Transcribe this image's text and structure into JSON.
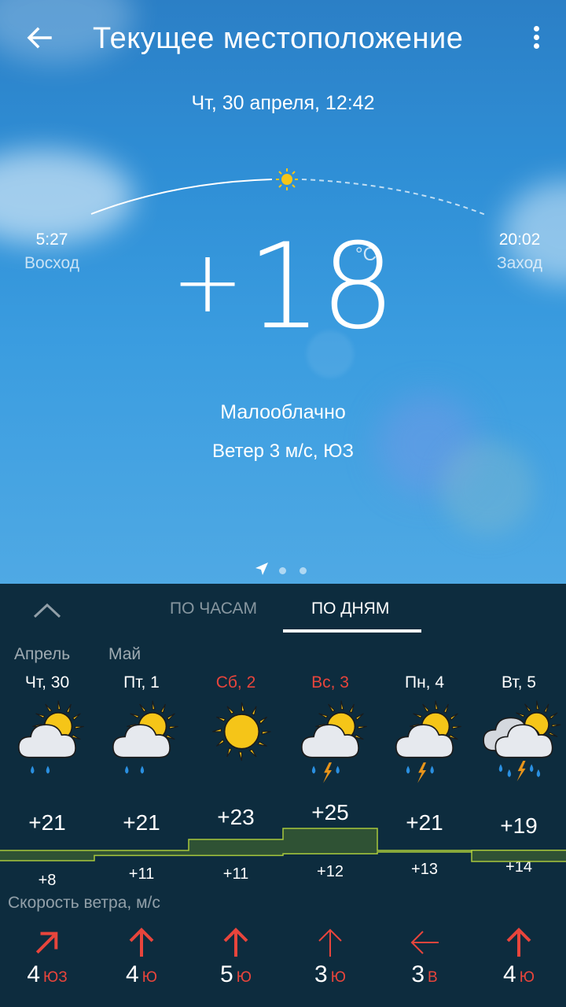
{
  "header": {
    "title": "Текущее местоположение",
    "datetime": "Чт, 30 апреля, 12:42"
  },
  "sun": {
    "sunrise_time": "5:27",
    "sunrise_label": "Восход",
    "sunset_time": "20:02",
    "sunset_label": "Заход"
  },
  "current": {
    "sign": "+",
    "temp": "18",
    "unit": "°C",
    "condition": "Малооблачно",
    "wind": "Ветер 3 м/с, ЮЗ"
  },
  "tabs": {
    "hours": "ПО ЧАСАМ",
    "days": "ПО ДНЯМ"
  },
  "months": [
    "Апрель",
    "Май"
  ],
  "days": [
    {
      "label": "Чт, 30",
      "weekend": false,
      "icon": "partly-cloudy-rain-icon",
      "max": "+21",
      "min": "+8",
      "wind_speed": "4",
      "wind_dir": "ЮЗ"
    },
    {
      "label": "Пт, 1",
      "weekend": false,
      "icon": "partly-cloudy-rain-icon",
      "max": "+21",
      "min": "+11",
      "wind_speed": "4",
      "wind_dir": "Ю"
    },
    {
      "label": "Сб, 2",
      "weekend": true,
      "icon": "sunny-icon",
      "max": "+23",
      "min": "+11",
      "wind_speed": "5",
      "wind_dir": "Ю"
    },
    {
      "label": "Вс, 3",
      "weekend": true,
      "icon": "partly-cloudy-thunderstorm-icon",
      "max": "+25",
      "min": "+12",
      "wind_speed": "3",
      "wind_dir": "Ю"
    },
    {
      "label": "Пн, 4",
      "weekend": false,
      "icon": "partly-cloudy-thunderstorm-icon",
      "max": "+21",
      "min": "+13",
      "wind_speed": "3",
      "wind_dir": "В"
    },
    {
      "label": "Вт, 5",
      "weekend": false,
      "icon": "cloudy-thunderstorm-icon",
      "max": "+19",
      "min": "+14",
      "wind_speed": "4",
      "wind_dir": "Ю"
    }
  ],
  "wind_title": "Скорость ветра, м/с",
  "colors": {
    "weekend": "#e8453c",
    "panel_bg": "#0d2c3e",
    "band_fill": "#2f5234",
    "band_edge": "#a8c83c",
    "sun": "#f5c518",
    "rain": "#2a8fe0",
    "lightning": "#e8941a",
    "wind_arrow": "#e8453c"
  }
}
